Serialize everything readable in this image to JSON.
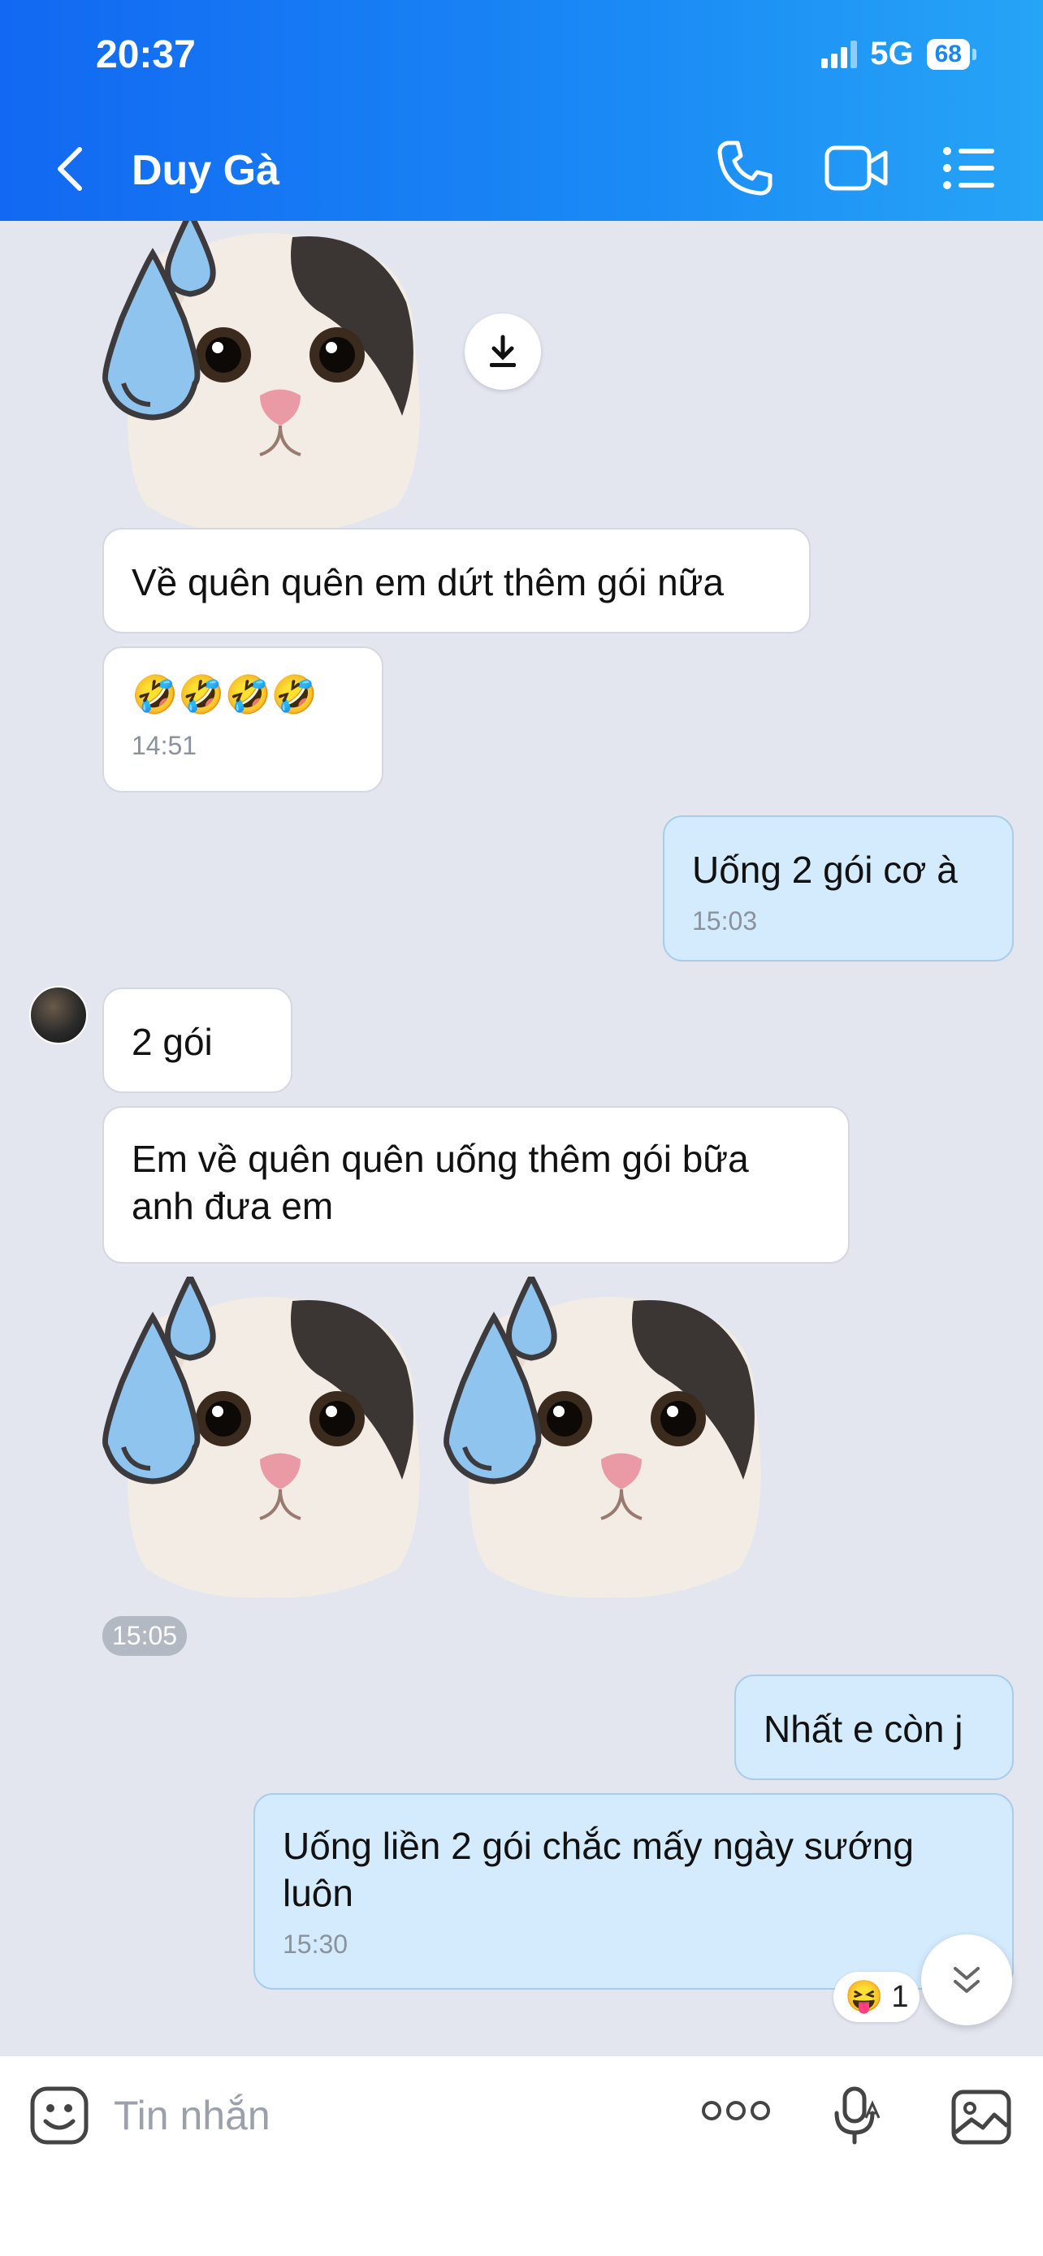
{
  "status_bar": {
    "time": "20:37",
    "network": "5G",
    "battery": "68"
  },
  "header": {
    "contact_name": "Duy Gà"
  },
  "messages": {
    "m1": {
      "text": "Về quên quên em dứt thêm gói nữa"
    },
    "m2": {
      "text": "🤣🤣🤣🤣",
      "time": "14:51"
    },
    "m3": {
      "text": "Uống 2 gói cơ à",
      "time": "15:03"
    },
    "m4": {
      "text": "2 gói"
    },
    "m5": {
      "text": "Em về quên quên uống thêm gói bữa anh đưa em"
    },
    "sticker_time": "15:05",
    "m6": {
      "text": "Nhất e còn j"
    },
    "m7": {
      "text": "Uống liền 2 gói chắc mấy ngày sướng luôn",
      "time": "15:30"
    }
  },
  "reaction": {
    "emoji": "😝",
    "count": "1"
  },
  "composer": {
    "placeholder": "Tin nhắn"
  },
  "colors": {
    "header_start": "#1268f2",
    "header_end": "#26a4f6",
    "outgoing_bubble": "#d4ebfd",
    "incoming_bubble": "#ffffff",
    "chat_bg": "#e3e6ef"
  },
  "icons": [
    "back-arrow-icon",
    "phone-icon",
    "video-camera-icon",
    "menu-list-icon",
    "download-icon",
    "chevron-down-icon",
    "sticker-face-icon",
    "more-dots-icon",
    "voice-mic-icon",
    "image-icon"
  ]
}
